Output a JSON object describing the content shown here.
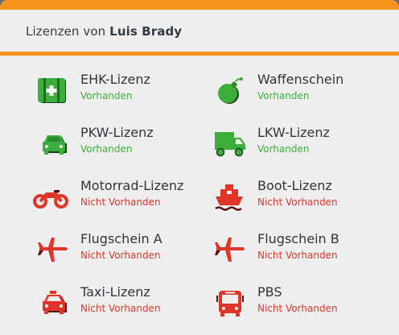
{
  "header": {
    "prefix": "Lizenzen von",
    "name": "Luis Brady"
  },
  "colors": {
    "accent": "#f7941d",
    "available": "#3cae3c",
    "unavailable": "#e0362a"
  },
  "licenses": [
    {
      "name": "EHK-Lizenz",
      "status": "Vorhanden",
      "icon": "first-aid-kit-icon"
    },
    {
      "name": "Waffenschein",
      "status": "Vorhanden",
      "icon": "bomb-icon"
    },
    {
      "name": "PKW-Lizenz",
      "status": "Vorhanden",
      "icon": "car-icon"
    },
    {
      "name": "LKW-Lizenz",
      "status": "Vorhanden",
      "icon": "truck-icon"
    },
    {
      "name": "Motorrad-Lizenz",
      "status": "Nicht Vorhanden",
      "icon": "motorcycle-icon"
    },
    {
      "name": "Boot-Lizenz",
      "status": "Nicht Vorhanden",
      "icon": "ship-icon"
    },
    {
      "name": "Flugschein A",
      "status": "Nicht Vorhanden",
      "icon": "plane-icon"
    },
    {
      "name": "Flugschein B",
      "status": "Nicht Vorhanden",
      "icon": "plane-icon"
    },
    {
      "name": "Taxi-Lizenz",
      "status": "Nicht Vorhanden",
      "icon": "taxi-icon"
    },
    {
      "name": "PBS",
      "status": "Nicht Vorhanden",
      "icon": "bus-icon"
    }
  ]
}
